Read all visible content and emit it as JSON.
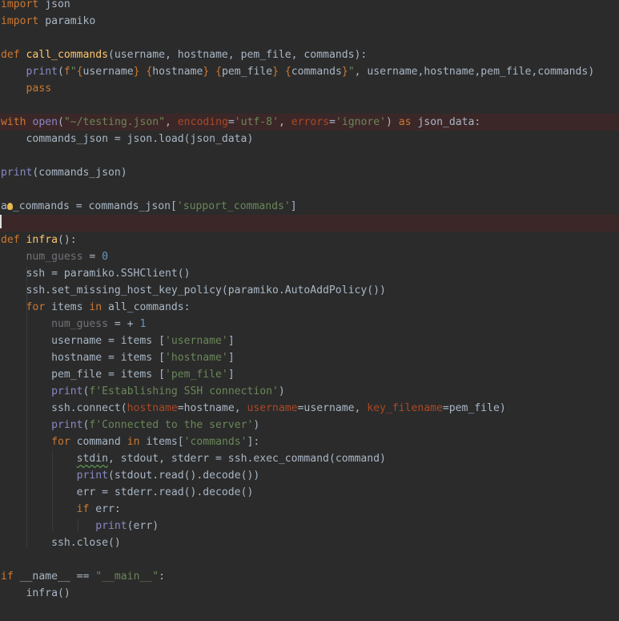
{
  "editor": {
    "language": "python",
    "theme_colors": {
      "background": "#2b2b2b",
      "keyword": "#cc7832",
      "function_name": "#ffc66d",
      "string": "#6a8759",
      "number": "#6897bb",
      "builtin": "#8888c6",
      "keyword_argument": "#aa4926",
      "default_text": "#a9b7c6",
      "error_line_background": "#3c2728"
    },
    "lines": [
      "import json",
      "import paramiko",
      "",
      "def call_commands(username, hostname, pem_file, commands):",
      "    print(f\"{username} {hostname} {pem_file} {commands}\", username,hostname,pem_file,commands)",
      "    pass",
      "",
      "with open(\"~/testing.json\", encoding='utf-8', errors='ignore') as json_data:",
      "    commands_json = json.load(json_data)",
      "",
      "print(commands_json)",
      "",
      "all_commands = commands_json['support_commands']",
      "",
      "def infra():",
      "    num_guess = 0",
      "    ssh = paramiko.SSHClient()",
      "    ssh.set_missing_host_key_policy(paramiko.AutoAddPolicy())",
      "    for items in all_commands:",
      "        num_guess = + 1",
      "        username = items ['username']",
      "        hostname = items ['hostname']",
      "        pem_file = items ['pem_file']",
      "        print(f'Establishing SSH connection')",
      "        ssh.connect(hostname=hostname, username=username, key_filename=pem_file)",
      "        print(f'Connected to the server')",
      "        for command in items['commands']:",
      "            stdin, stdout, stderr = ssh.exec_command(command)",
      "            print(stdout.read().decode())",
      "            err = stderr.read().decode()",
      "            if err:",
      "               print(err)",
      "        ssh.close()",
      "",
      "if __name__ == \"__main__\":",
      "    infra()"
    ],
    "error_lines": [
      8,
      14
    ]
  }
}
